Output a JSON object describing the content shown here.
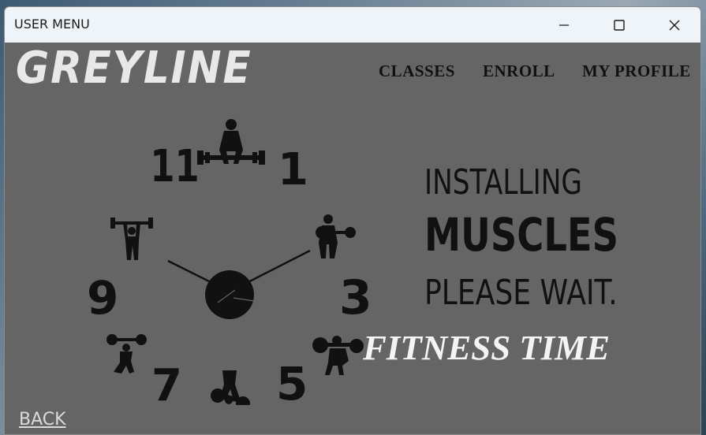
{
  "window": {
    "title": "USER MENU"
  },
  "header": {
    "logo": "GREYLINE",
    "nav": [
      {
        "label": "CLASSES"
      },
      {
        "label": "ENROLL"
      },
      {
        "label": "MY PROFILE"
      }
    ]
  },
  "clock": {
    "numerals": [
      "11",
      "1",
      "9",
      "3",
      "7",
      "5"
    ]
  },
  "slogan": {
    "line1": "INSTALLING",
    "line2": "MUSCLES",
    "line3": "PLEASE WAIT."
  },
  "tagline": "FITNESS TIME",
  "footer": {
    "back_label": "BACK"
  },
  "icons": {
    "minimize": "minimize-icon",
    "maximize": "maximize-icon",
    "close": "close-icon"
  },
  "colors": {
    "background": "#656565",
    "titlebar": "#eff4f9",
    "logo": "#e8e8e8",
    "nav": "#111111",
    "tagline": "#f4f4f4"
  }
}
